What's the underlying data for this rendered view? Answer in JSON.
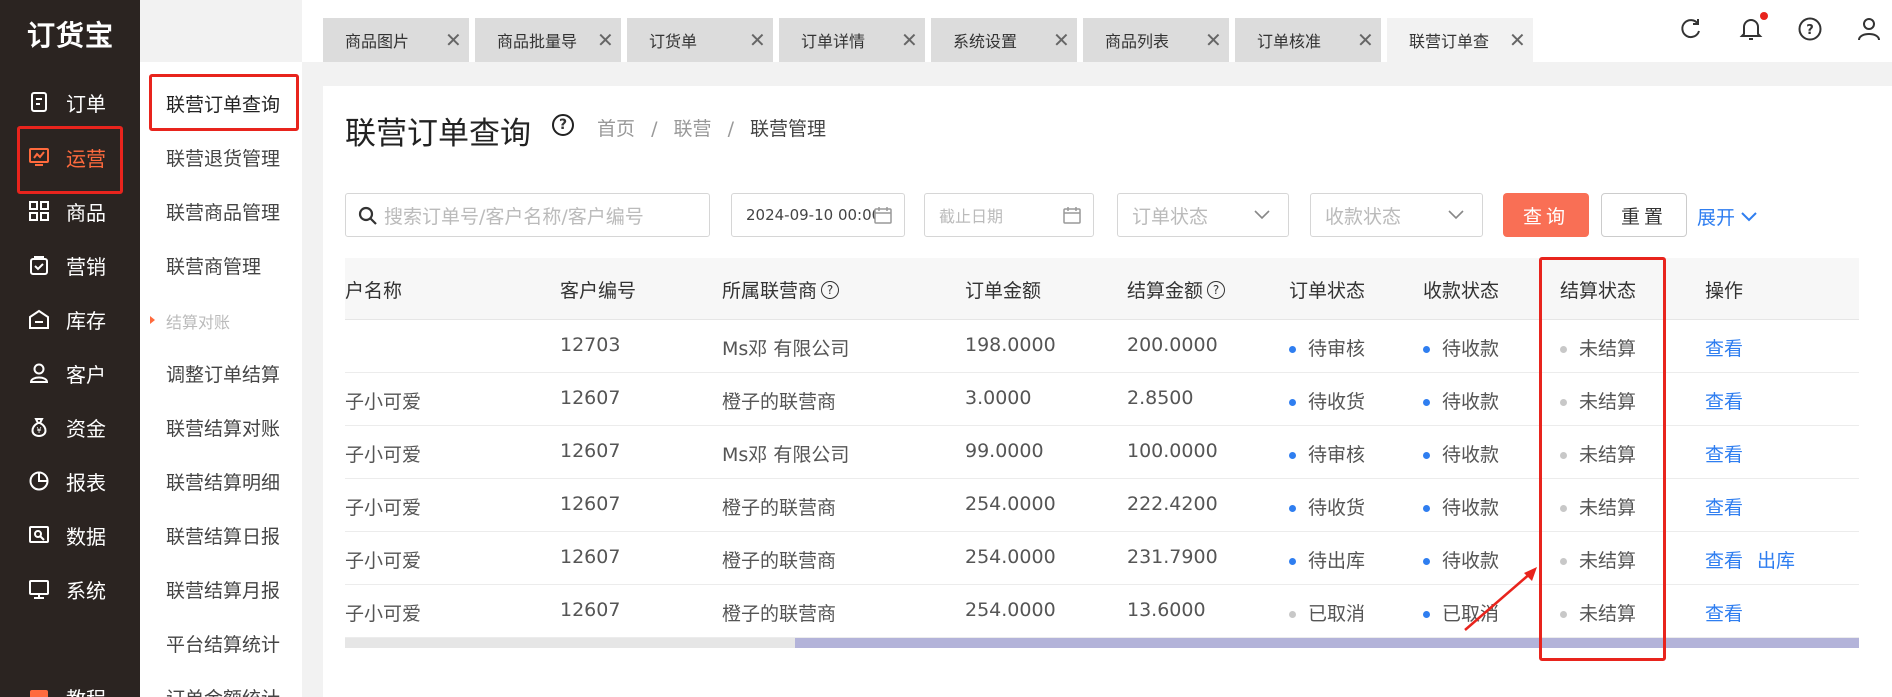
{
  "app": {
    "logo": "订货宝"
  },
  "sidebar": {
    "items": [
      {
        "label": "订单",
        "icon": "order-icon"
      },
      {
        "label": "运营",
        "icon": "operations-icon",
        "active": true
      },
      {
        "label": "商品",
        "icon": "grid-icon"
      },
      {
        "label": "营销",
        "icon": "marketing-icon"
      },
      {
        "label": "库存",
        "icon": "warehouse-icon"
      },
      {
        "label": "客户",
        "icon": "user-icon"
      },
      {
        "label": "资金",
        "icon": "money-bag-icon"
      },
      {
        "label": "报表",
        "icon": "pie-chart-icon"
      },
      {
        "label": "数据",
        "icon": "data-icon"
      },
      {
        "label": "系统",
        "icon": "monitor-icon"
      }
    ],
    "partial_item": "教程"
  },
  "submenu": {
    "items": [
      "联营订单查询",
      "联营退货管理",
      "联营商品管理",
      "联营商管理"
    ],
    "group_label": "结算对账",
    "group_items": [
      "调整订单结算",
      "联营结算对账",
      "联营结算明细",
      "联营结算日报",
      "联营结算月报",
      "平台结算统计",
      "订单金额统计"
    ]
  },
  "tabs": [
    {
      "label": "商品图片"
    },
    {
      "label": "商品批量导"
    },
    {
      "label": "订货单"
    },
    {
      "label": "订单详情"
    },
    {
      "label": "系统设置"
    },
    {
      "label": "商品列表"
    },
    {
      "label": "订单核准"
    },
    {
      "label": "联营订单查",
      "active": true
    }
  ],
  "tab_close": "✕",
  "header_icons": [
    "refresh-icon",
    "bell-icon",
    "help-icon",
    "user-icon"
  ],
  "page": {
    "title": "联营订单查询",
    "help": "?",
    "breadcrumb": [
      "首页",
      "/",
      "联营",
      "/",
      "联营管理"
    ]
  },
  "filters": {
    "search_placeholder": "搜索订单号/客户名称/客户编号",
    "start_date": "2024-09-10 00:00",
    "end_date_placeholder": "截止日期",
    "order_status_placeholder": "订单状态",
    "payment_status_placeholder": "收款状态",
    "query_label": "查询",
    "reset_label": "重置",
    "expand_label": "展开"
  },
  "table": {
    "columns": [
      "户名称",
      "客户编号",
      "所属联营商",
      "订单金额",
      "结算金额",
      "订单状态",
      "收款状态",
      "结算状态",
      "操作"
    ],
    "rows": [
      {
        "name": "",
        "code": "12703",
        "vendor": "Ms邓 有限公司",
        "amount": "198.0000",
        "settle": "200.0000",
        "order_status": "待审核",
        "pay_status": "待收款",
        "settle_status": "未结算",
        "actions": [
          "查看"
        ]
      },
      {
        "name": "子小可爱",
        "code": "12607",
        "vendor": "橙子的联营商",
        "amount": "3.0000",
        "settle": "2.8500",
        "order_status": "待收货",
        "pay_status": "待收款",
        "settle_status": "未结算",
        "actions": [
          "查看"
        ]
      },
      {
        "name": "子小可爱",
        "code": "12607",
        "vendor": "Ms邓 有限公司",
        "amount": "99.0000",
        "settle": "100.0000",
        "order_status": "待审核",
        "pay_status": "待收款",
        "settle_status": "未结算",
        "actions": [
          "查看"
        ]
      },
      {
        "name": "子小可爱",
        "code": "12607",
        "vendor": "橙子的联营商",
        "amount": "254.0000",
        "settle": "222.4200",
        "order_status": "待收货",
        "pay_status": "待收款",
        "settle_status": "未结算",
        "actions": [
          "查看"
        ]
      },
      {
        "name": "子小可爱",
        "code": "12607",
        "vendor": "橙子的联营商",
        "amount": "254.0000",
        "settle": "231.7900",
        "order_status": "待出库",
        "pay_status": "待收款",
        "settle_status": "未结算",
        "actions": [
          "查看",
          "出库"
        ]
      },
      {
        "name": "子小可爱",
        "code": "12607",
        "vendor": "橙子的联营商",
        "amount": "254.0000",
        "settle": "13.6000",
        "order_status": "已取消",
        "pay_status": "已取消",
        "settle_status": "未结算",
        "actions": [
          "查看"
        ]
      }
    ]
  },
  "colors": {
    "sidebar_bg": "#2b2421",
    "accent": "#ff6a3d",
    "highlight_box": "#e8241d",
    "link": "#2f7ef0",
    "status_blue": "#2f7ef0",
    "status_grey": "#c8c8c8",
    "query_button": "#f96f55"
  }
}
